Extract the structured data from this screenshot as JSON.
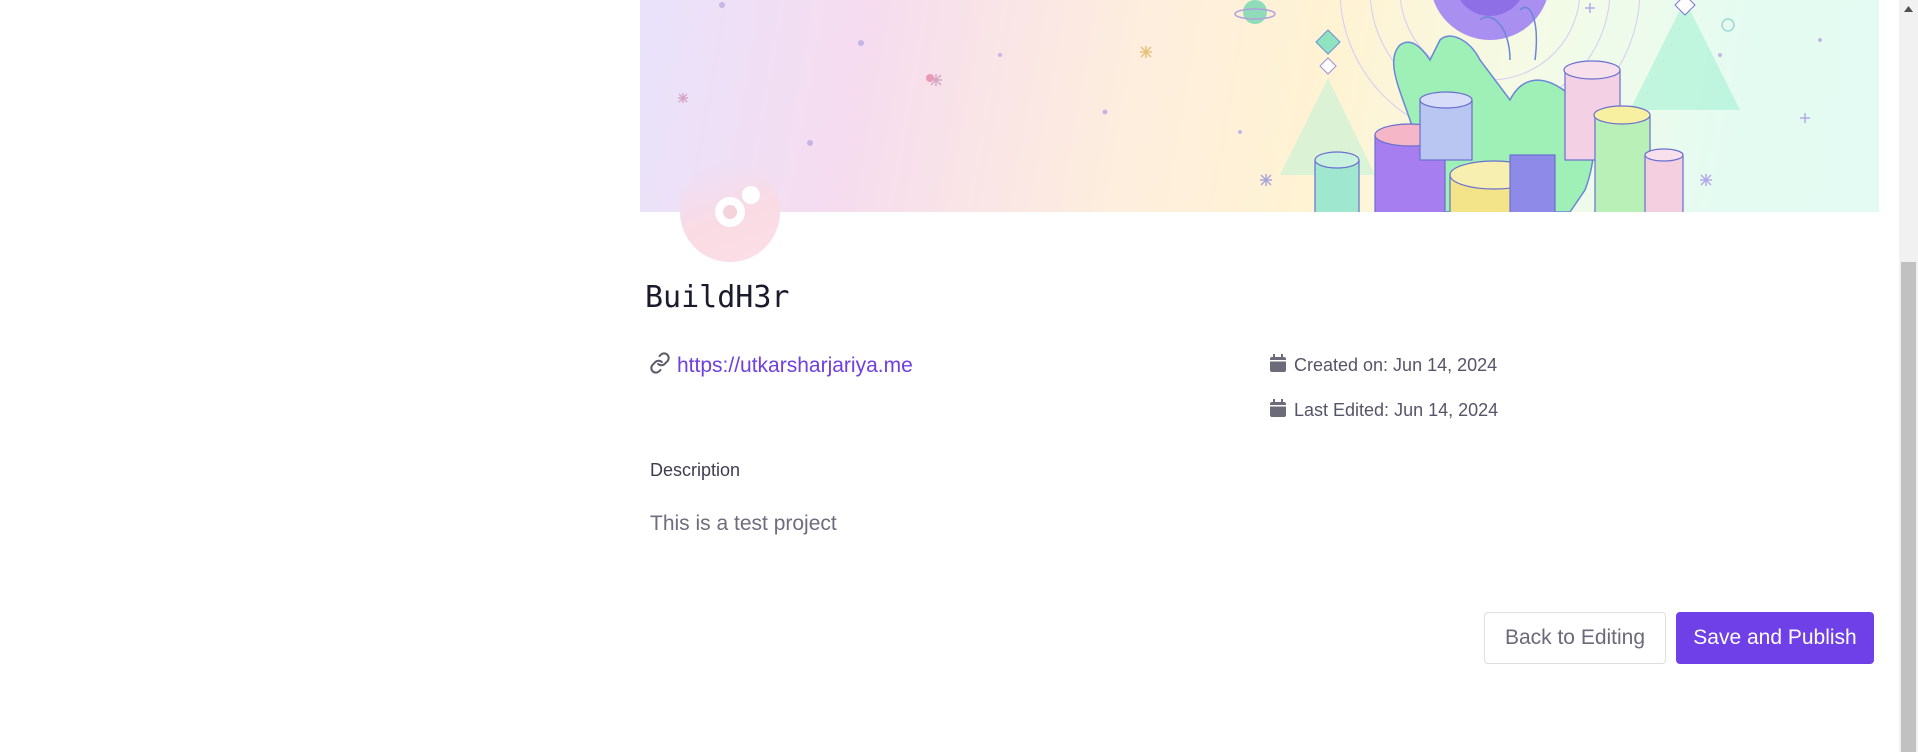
{
  "project": {
    "name": "BuildH3r",
    "website_url": "https://utkarsharjariya.me",
    "created_on": "Created on: Jun 14, 2024",
    "last_edited": "Last Edited: Jun 14, 2024",
    "description_label": "Description",
    "description": "This is a test project"
  },
  "actions": {
    "back_label": "Back to Editing",
    "save_label": "Save and Publish"
  },
  "icons": {
    "link": "link-icon",
    "calendar": "calendar-icon",
    "scroll_up": "scroll-up-arrow-icon"
  },
  "colors": {
    "accent": "#6f3fe8",
    "link": "#6f3fe0",
    "text": "#1b1b2e",
    "muted": "#6d6d7d"
  }
}
